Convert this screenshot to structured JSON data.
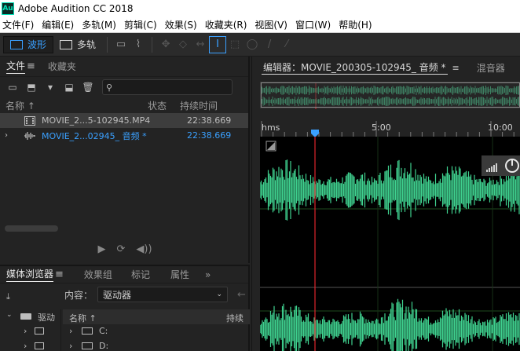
{
  "window": {
    "icon_label": "Au",
    "title": "Adobe Audition CC 2018"
  },
  "menu": [
    "文件(F)",
    "编辑(E)",
    "多轨(M)",
    "剪辑(C)",
    "效果(S)",
    "收藏夹(R)",
    "视图(V)",
    "窗口(W)",
    "帮助(H)"
  ],
  "toolbar": {
    "waveform_label": "波形",
    "multitrack_label": "多轨"
  },
  "files_panel": {
    "tab_files": "文件",
    "tab_favorites": "收藏夹",
    "col_name": "名称",
    "col_status": "状态",
    "col_duration": "持续时间",
    "rows": [
      {
        "name": "MOVIE_2...5-102945.MP4",
        "duration": "22:38.669"
      },
      {
        "name": "MOVIE_2...02945_ 音频 *",
        "duration": "22:38.669"
      }
    ]
  },
  "media_panel": {
    "tab_media_browser": "媒体浏览器",
    "tab_effects_group": "效果组",
    "tab_markers": "标记",
    "tab_properties": "属性",
    "content_label": "内容：",
    "content_value": "驱动器",
    "tree_root": "驱动",
    "col_duration": "持续",
    "drives": [
      "C:",
      "D:"
    ]
  },
  "editor": {
    "tab_editor": "编辑器：MOVIE_200305-102945_ 音频 *",
    "tab_mixer": "混音器",
    "ruler_unit": "hms",
    "ruler_ticks": [
      "5:00",
      "10:00"
    ]
  },
  "colors": {
    "accent": "#3aa0ff",
    "waveform": "#3fd18f",
    "playhead": "#e0242c"
  }
}
